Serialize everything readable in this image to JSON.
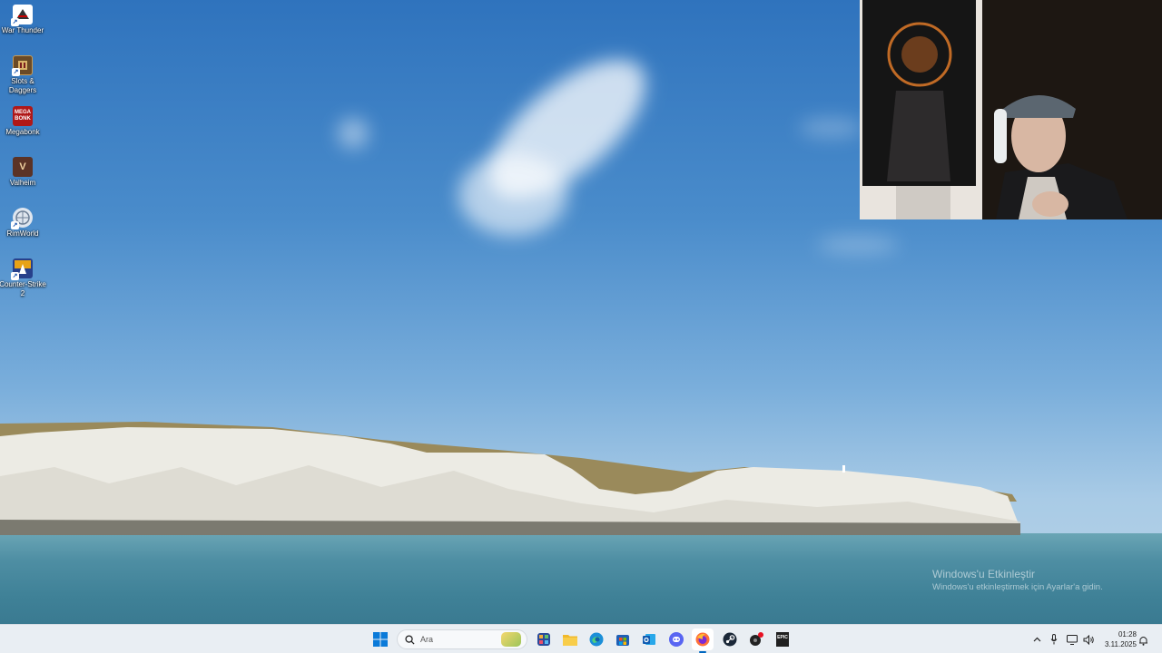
{
  "desktop": {
    "icons": [
      {
        "label": "War Thunder",
        "icon": "war-thunder-icon"
      },
      {
        "label": "Slots & Daggers",
        "icon": "slots-daggers-icon"
      },
      {
        "label": "Megabonk",
        "icon": "megabonk-icon",
        "badge": "MEGA BONK"
      },
      {
        "label": "Valheim",
        "icon": "valheim-icon",
        "badge": "V"
      },
      {
        "label": "RimWorld",
        "icon": "rimworld-icon"
      },
      {
        "label": "Counter-Strike 2",
        "icon": "counter-strike-2-icon"
      }
    ]
  },
  "watermark": {
    "title": "Windows'u Etkinleştir",
    "subtitle": "Windows'u etkinleştirmek için Ayarlar'a gidin."
  },
  "taskbar": {
    "search_placeholder": "Ara",
    "apps": [
      {
        "name": "start-button",
        "icon": "windows-logo-icon"
      },
      {
        "name": "copilot",
        "icon": "copilot-icon"
      },
      {
        "name": "file-explorer",
        "icon": "folder-icon"
      },
      {
        "name": "edge",
        "icon": "edge-icon"
      },
      {
        "name": "microsoft-store",
        "icon": "store-icon"
      },
      {
        "name": "outlook",
        "icon": "outlook-icon"
      },
      {
        "name": "discord",
        "icon": "discord-icon"
      },
      {
        "name": "firefox",
        "icon": "firefox-icon",
        "active": true
      },
      {
        "name": "steam",
        "icon": "steam-icon"
      },
      {
        "name": "steam-notify",
        "icon": "steam-badge-icon"
      },
      {
        "name": "epic-games",
        "icon": "epic-games-icon",
        "badge": "EPIC"
      }
    ],
    "clock": {
      "time": "01:28",
      "date": "3.11.2025"
    }
  },
  "colors": {
    "taskbar_bg": "#e9eef3",
    "accent": "#0067c0",
    "sky_top": "#2f73bd",
    "sea": "#3f8197"
  }
}
